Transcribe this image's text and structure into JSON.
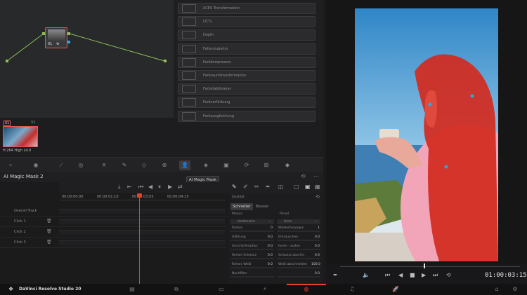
{
  "app": {
    "name": "DaVinci Resolve Studio 20"
  },
  "node": {
    "label": "01"
  },
  "effects": {
    "items": [
      "ACES Transformation",
      "DCTL",
      "Depth",
      "Fehlerzubehör",
      "Farbkompressor",
      "Farbraumtransformation",
      "Farbstabilisierer",
      "Farbverfärbung",
      "Farbausgleichung"
    ]
  },
  "clip": {
    "number": "01",
    "track": "V1",
    "codec": "H.264 High L4.0"
  },
  "mask": {
    "title": "AI Magic Mask 2",
    "tooltip": "AI Magic Mask",
    "ruler": [
      "00:00:00:00",
      "00:00:01:10",
      "00:00:03:05",
      "00:00:04:15"
    ],
    "tracks": [
      "Overall Track",
      "Click 1",
      "Click 2",
      "Click 3"
    ]
  },
  "settings": {
    "header": "Qualität",
    "quality_options": [
      "Schneller",
      "Besser"
    ],
    "modus_label": "Modus",
    "pinsel_label": "Pinsel",
    "modus_value": "Verbessern",
    "pinsel_value": "Kreis",
    "rows": [
      {
        "l1": "Radius",
        "v1": "0",
        "l2": "Wiederholungen",
        "v2": "1"
      },
      {
        "l1": "Glättung",
        "v1": "0.0",
        "l2": "Entrauschen",
        "v2": "0.0"
      },
      {
        "l1": "Unschärferadius",
        "v1": "0.0",
        "l2": "Innen - außen",
        "v2": "0.0"
      },
      {
        "l1": "Reines Schwarz",
        "v1": "0.0",
        "l2": "Schwarz abschn.",
        "v2": "0.0"
      },
      {
        "l1": "Reines Weiß",
        "v1": "0.0",
        "l2": "Weiß abschneiden",
        "v2": "100.0"
      },
      {
        "l1": "Nachfilter",
        "v1": "",
        "l2": "",
        "v2": "0.0"
      }
    ]
  },
  "viewer": {
    "timecode": "01:00:03:15"
  },
  "colors": {
    "accent": "#e8402a",
    "mask": "#d22a1e",
    "point": "#29a8e0"
  }
}
